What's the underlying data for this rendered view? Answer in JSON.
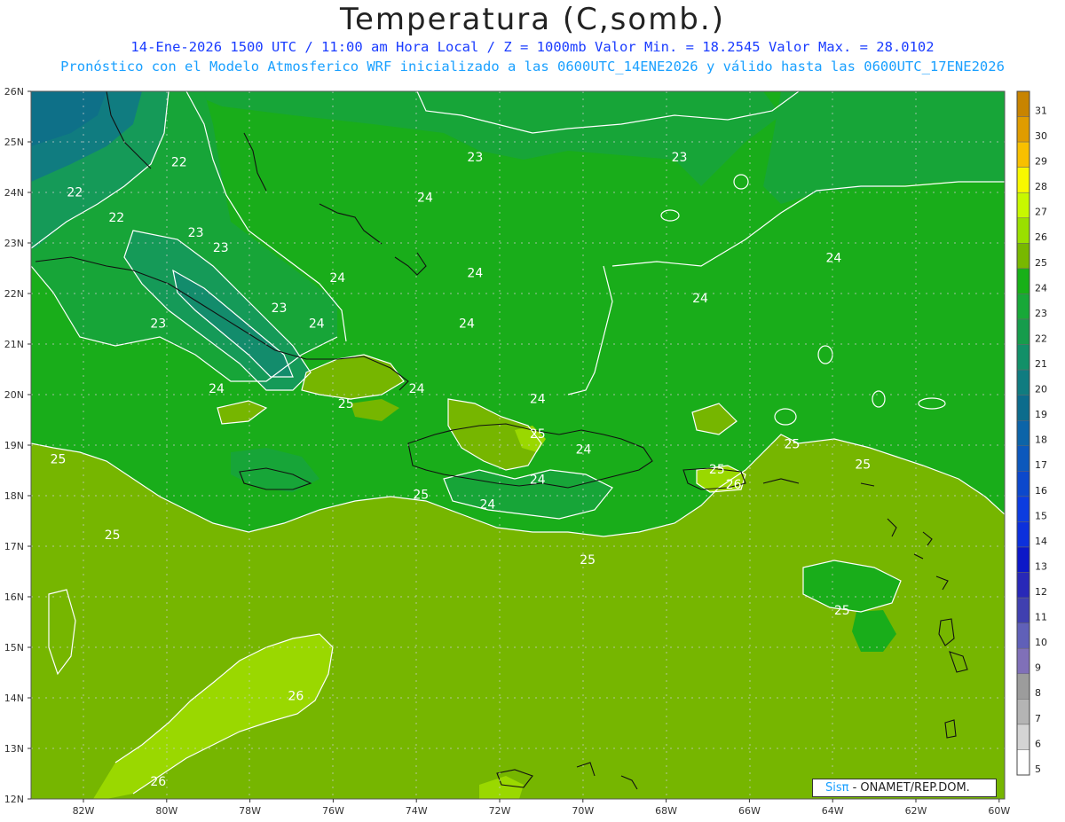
{
  "header": {
    "title": "Temperatura (C,somb.)",
    "line1": "14-Ene-2026 1500 UTC / 11:00 am Hora Local / Z = 1000mb  Valor Min. = 18.2545  Valor Max. = 28.0102",
    "line2": "Pronóstico con el Modelo Atmosferico WRF inicializado a las 0600UTC_14ENE2026 y válido hasta las  0600UTC_17ENE2026"
  },
  "map": {
    "lat_labels": [
      "26N",
      "25N",
      "24N",
      "23N",
      "22N",
      "21N",
      "20N",
      "19N",
      "18N",
      "17N",
      "16N",
      "15N",
      "14N",
      "13N",
      "12N"
    ],
    "lon_labels": [
      "82W",
      "80W",
      "78W",
      "76W",
      "74W",
      "72W",
      "70W",
      "68W",
      "66W",
      "64W",
      "62W",
      "60W"
    ],
    "contour_labels": [
      {
        "text": "22",
        "lon": -79.7,
        "lat": 24.6
      },
      {
        "text": "22",
        "lon": -82.2,
        "lat": 24.0
      },
      {
        "text": "22",
        "lon": -81.2,
        "lat": 23.5
      },
      {
        "text": "23",
        "lon": -79.3,
        "lat": 23.2
      },
      {
        "text": "23",
        "lon": -78.7,
        "lat": 22.9
      },
      {
        "text": "23",
        "lon": -80.2,
        "lat": 21.4
      },
      {
        "text": "23",
        "lon": -77.3,
        "lat": 21.7
      },
      {
        "text": "23",
        "lon": -72.6,
        "lat": 24.7
      },
      {
        "text": "23",
        "lon": -67.7,
        "lat": 24.7
      },
      {
        "text": "24",
        "lon": -73.8,
        "lat": 23.9
      },
      {
        "text": "24",
        "lon": -75.9,
        "lat": 22.3
      },
      {
        "text": "24",
        "lon": -72.6,
        "lat": 22.4
      },
      {
        "text": "24",
        "lon": -76.4,
        "lat": 21.4
      },
      {
        "text": "24",
        "lon": -72.8,
        "lat": 21.4
      },
      {
        "text": "24",
        "lon": -78.8,
        "lat": 20.1
      },
      {
        "text": "24",
        "lon": -74.0,
        "lat": 20.1
      },
      {
        "text": "24",
        "lon": -67.2,
        "lat": 21.9
      },
      {
        "text": "24",
        "lon": -64.0,
        "lat": 22.7
      },
      {
        "text": "24",
        "lon": -71.1,
        "lat": 19.9
      },
      {
        "text": "24",
        "lon": -70.0,
        "lat": 18.9
      },
      {
        "text": "24",
        "lon": -71.1,
        "lat": 18.3
      },
      {
        "text": "24",
        "lon": -72.3,
        "lat": 17.8
      },
      {
        "text": "25",
        "lon": -75.7,
        "lat": 19.8
      },
      {
        "text": "25",
        "lon": -82.6,
        "lat": 18.7
      },
      {
        "text": "25",
        "lon": -81.3,
        "lat": 17.2
      },
      {
        "text": "25",
        "lon": -73.9,
        "lat": 18.0
      },
      {
        "text": "25",
        "lon": -71.1,
        "lat": 19.2
      },
      {
        "text": "25",
        "lon": -66.8,
        "lat": 18.5
      },
      {
        "text": "25",
        "lon": -69.9,
        "lat": 16.7
      },
      {
        "text": "25",
        "lon": -65.0,
        "lat": 19.0
      },
      {
        "text": "25",
        "lon": -63.3,
        "lat": 18.6
      },
      {
        "text": "25",
        "lon": -63.8,
        "lat": 15.7
      },
      {
        "text": "26",
        "lon": -66.4,
        "lat": 18.2
      },
      {
        "text": "26",
        "lon": -76.9,
        "lat": 14.0
      },
      {
        "text": "26",
        "lon": -80.2,
        "lat": 12.3
      }
    ]
  },
  "colorbar": {
    "labels": [
      "31",
      "30",
      "29",
      "28",
      "27",
      "26",
      "25",
      "24",
      "23",
      "22",
      "21",
      "20",
      "19",
      "18",
      "17",
      "16",
      "15",
      "14",
      "13",
      "12",
      "11",
      "10",
      "9",
      "8",
      "7",
      "6",
      "5"
    ],
    "colors": [
      "#c88400",
      "#e09c00",
      "#f8c000",
      "#f8f800",
      "#c8f800",
      "#9ae000",
      "#78b800",
      "#18b018",
      "#18a838",
      "#169c4c",
      "#129068",
      "#107c80",
      "#0c6c8c",
      "#0c64a8",
      "#0c58bc",
      "#0c48cc",
      "#0c3ce0",
      "#0c30dc",
      "#0c18c8",
      "#2828b8",
      "#4040b0",
      "#6060b8",
      "#8070b8",
      "#9c9c9c",
      "#b4b4b4",
      "#d4d4d4",
      "#ffffff"
    ]
  },
  "credit": {
    "sis": "Sisπ",
    "rest": " - ONAMET/REP.DOM."
  }
}
